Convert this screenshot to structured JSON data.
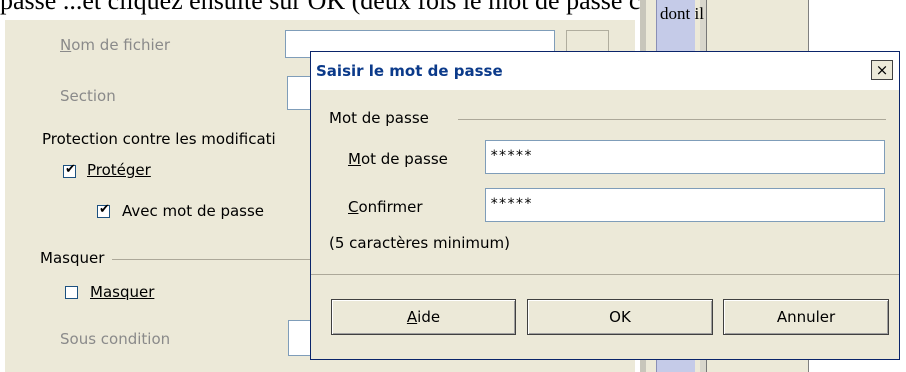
{
  "background": {
    "top_text": "passe ...et cliquez ensuite sur OK (deux fois le mot de passe contre les fautes de frappe)",
    "page_word": "dont il",
    "form": {
      "file_name_label": "Nom de fichier",
      "section_label": "Section",
      "protection_heading": "Protection contre les modificati",
      "protect_label": "Protéger",
      "protect_checked": true,
      "with_password_label": "Avec mot de passe",
      "with_password_checked": true,
      "hide_heading": "Masquer",
      "hide_label": "Masquer",
      "hide_checked": false,
      "condition_label": "Sous condition"
    }
  },
  "dialog": {
    "title": "Saisir le mot de passe",
    "close_glyph": "×",
    "group_label": "Mot de passe",
    "password_label": "Mot de passe",
    "password_value": "*****",
    "confirm_label": "Confirmer",
    "confirm_value": "*****",
    "hint": "(5 caractères minimum)",
    "buttons": {
      "help": "Aide",
      "ok": "OK",
      "cancel": "Annuler"
    }
  },
  "colors": {
    "dialog_bg": "#ece9d8",
    "title_text": "#0b3a8a",
    "field_border": "#7f9db9",
    "page_blue": "#c5cbe8"
  }
}
